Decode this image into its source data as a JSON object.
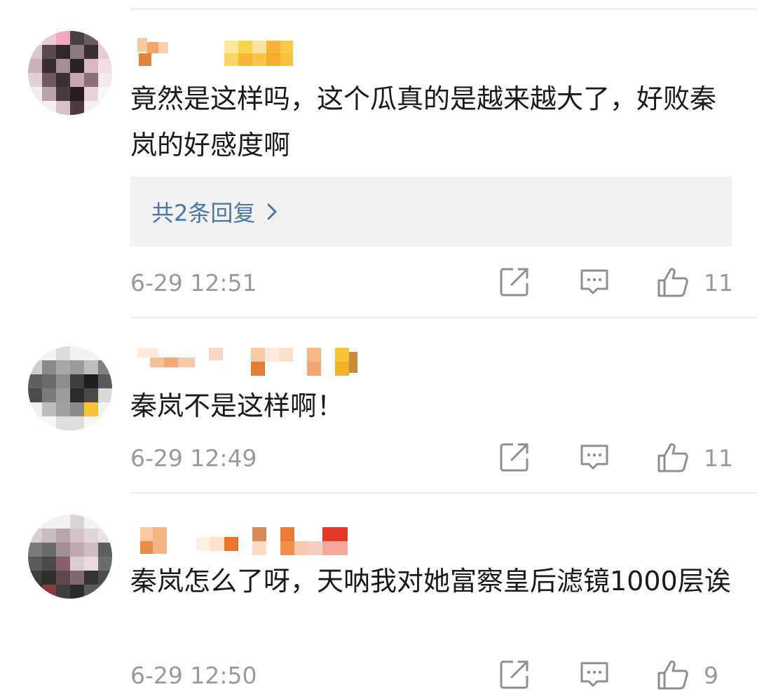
{
  "comments": [
    {
      "text": "竟然是这样吗，这个瓜真的是越来越大了，好败秦岚的好感度啊",
      "replies_label": "共2条回复",
      "time": "6-29 12:51",
      "likes": "11"
    },
    {
      "text": "秦岚不是这样啊！",
      "time": "6-29 12:49",
      "likes": "11"
    },
    {
      "text": "秦岚怎么了呀，天呐我对她富察皇后滤镜1000层诶",
      "time": "6-29 12:50",
      "likes": "9"
    }
  ],
  "icons": {
    "share": "share-icon",
    "comment": "comment-icon",
    "like": "thumbs-up-icon",
    "chevron": "chevron-right-icon"
  },
  "colors": {
    "link": "#4a76a8",
    "meta": "#9a9a9a",
    "divider": "#ececec",
    "reply_bg": "#f2f2f2"
  }
}
